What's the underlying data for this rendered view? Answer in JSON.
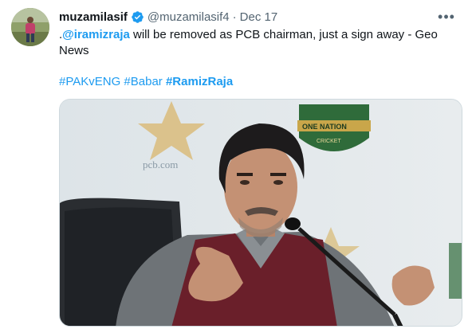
{
  "tweet": {
    "display_name": "muzamilasif",
    "handle": "@muzamilasif4",
    "separator": "·",
    "time": "Dec 17",
    "more_icon": "more-horizontal-icon",
    "verified_icon": "verified-badge-icon",
    "text_prefix": ".",
    "mention": "@iramizraja",
    "text_body": " will be removed as PCB chairman, just a sign away - Geo News",
    "hashtags": [
      "#PAKvENG",
      "#Babar",
      "#RamizRaja"
    ],
    "media": {
      "kind": "photo",
      "backdrop_text_1": "pcb.com",
      "backdrop_text_2": "ONE NATION",
      "backdrop_text_3": "CRICKET"
    }
  },
  "colors": {
    "link": "#1d9bf0",
    "text": "#0f1419",
    "muted": "#536471",
    "verified": "#1d9bf0"
  }
}
